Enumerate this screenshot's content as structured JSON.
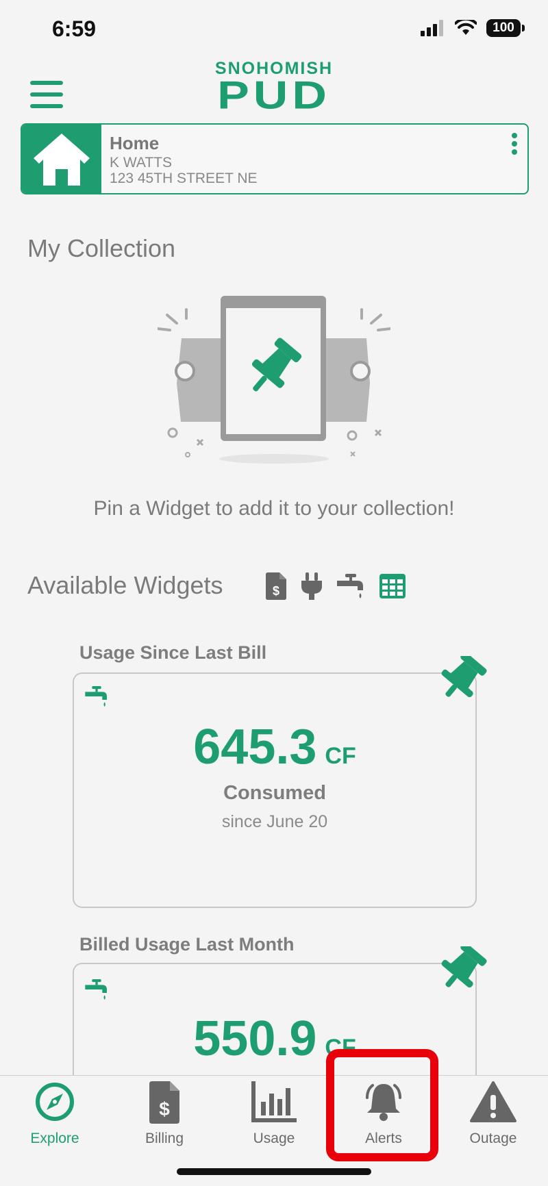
{
  "status_bar": {
    "time": "6:59",
    "battery": "100"
  },
  "header": {
    "logo_top": "SNOHOMISH",
    "logo_main": "PUD"
  },
  "account": {
    "label": "Home",
    "name": "K WATTS",
    "address": "123 45TH STREET NE"
  },
  "my_collection": {
    "title": "My Collection",
    "empty_message": "Pin a Widget to add it to your collection!"
  },
  "available_widgets": {
    "title": "Available Widgets",
    "filters": [
      "bill-icon",
      "plug-icon",
      "faucet-icon",
      "grid-icon"
    ]
  },
  "widgets": [
    {
      "title": "Usage Since Last Bill",
      "value": "645.3",
      "unit": "CF",
      "label": "Consumed",
      "sub": "since June 20"
    },
    {
      "title": "Billed Usage Last Month",
      "value": "550.9",
      "unit": "CF"
    }
  ],
  "tabs": [
    {
      "label": "Explore",
      "active": true
    },
    {
      "label": "Billing"
    },
    {
      "label": "Usage"
    },
    {
      "label": "Alerts"
    },
    {
      "label": "Outage"
    }
  ],
  "colors": {
    "accent": "#1e9d71",
    "highlight": "#e8000b"
  }
}
